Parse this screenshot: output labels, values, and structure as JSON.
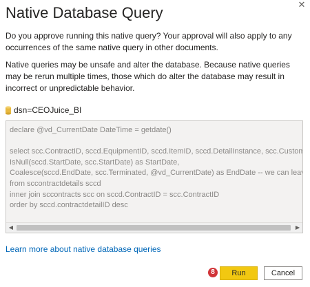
{
  "dialog": {
    "title": "Native Database Query",
    "close_glyph": "✕",
    "approval_text": "Do you approve running this native query? Your approval will also apply to any occurrences of the same native query in other documents.",
    "warning_text": "Native queries may be unsafe and alter the database. Because native queries may be rerun multiple times, those which do alter the database may result in incorrect or unpredictable behavior.",
    "dsn_icon": "database-icon",
    "dsn_label": "dsn=CEOJuice_BI",
    "query_text": "declare @vd_CurrentDate DateTime = getdate()\n\nselect scc.ContractID, sccd.EquipmentID, sccd.ItemID, sccd.DetailInstance, scc.CustomerID,\nIsNull(sccd.StartDate, scc.StartDate) as StartDate,\nCoalesce(sccd.EndDate, scc.Terminated, @vd_CurrentDate) as EndDate -- we can leave the N\nfrom sccontractdetails sccd\ninner join sccontracts scc on sccd.ContractID = scc.ContractID\norder by sccd.contractdetailID desc",
    "learn_more_link": "Learn more about native database queries",
    "step_badge": "8",
    "run_label": "Run",
    "cancel_label": "Cancel"
  },
  "colors": {
    "run_button": "#f2c811",
    "link": "#0067b8",
    "badge": "#d13438",
    "db_icon": "#e8b940"
  }
}
